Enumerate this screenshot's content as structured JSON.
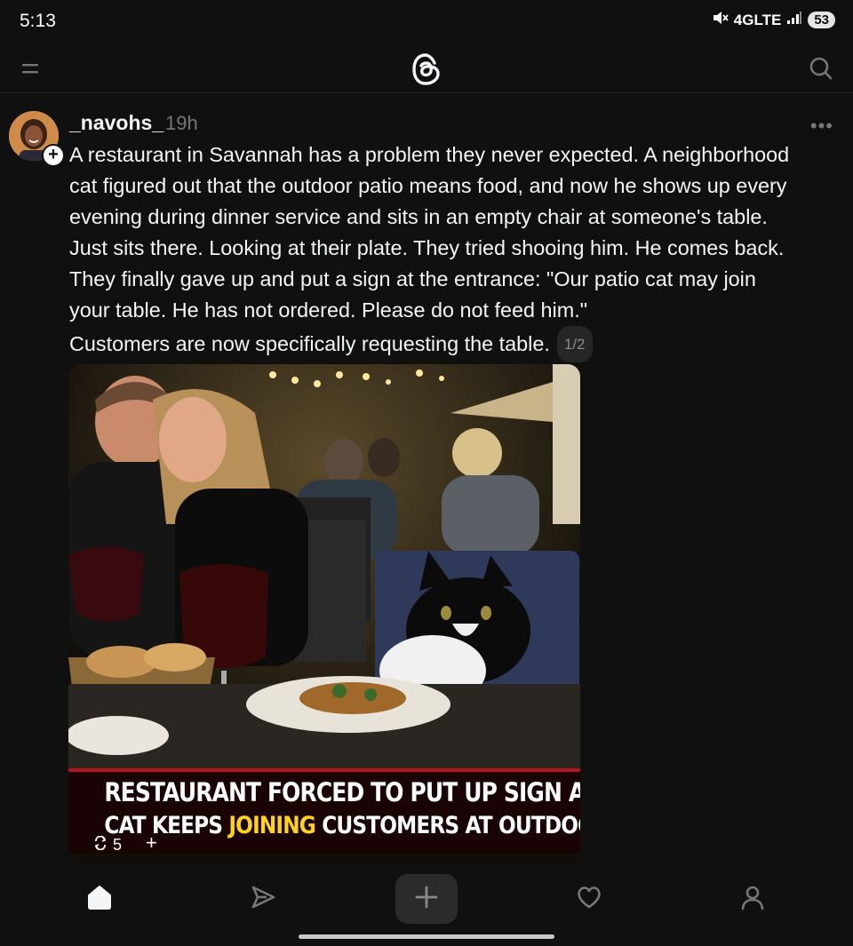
{
  "status_bar": {
    "time": "5:13",
    "network": "4GLTE",
    "battery": "53"
  },
  "header": {
    "menu_icon": "menu-icon",
    "logo": "threads-logo",
    "search_icon": "search-icon"
  },
  "post": {
    "username": "_navohs_",
    "timestamp": "19h",
    "more_icon": "more-horizontal-icon",
    "text_lines": [
      "A restaurant in Savannah has a problem they never expected. A neighborhood",
      "cat figured out that the outdoor patio means food, and now he shows up every",
      "evening during dinner service and sits in an empty chair at someone's table.",
      "Just sits there. Looking at their plate. They tried shooing him. He comes back.",
      "They finally gave up and put a sign at the entrance: \"Our patio cat may join",
      "your table. He has not ordered. Please do not feed him.\"",
      "Customers are now specifically requesting the table."
    ],
    "page_indicator": "1/2",
    "media": {
      "headline_line1": "RESTAURANT FORCED TO PUT UP SIGN AFTER",
      "headline_line2_prefix": "CAT KEEPS ",
      "headline_line2_highlight": "JOINING",
      "headline_line2_suffix": " CUSTOMERS AT OUTDOOR TABLES",
      "repost_count": "5",
      "add_label": "+"
    }
  },
  "bottom_nav": {
    "items": [
      "home-icon",
      "send-icon",
      "create-icon",
      "heart-icon",
      "profile-icon"
    ],
    "create_label": "+"
  },
  "colors": {
    "background": "#101010",
    "text": "#f3f5f7",
    "muted": "#777777",
    "headline_highlight": "#ffd21f",
    "headline_border": "#b5141c"
  }
}
